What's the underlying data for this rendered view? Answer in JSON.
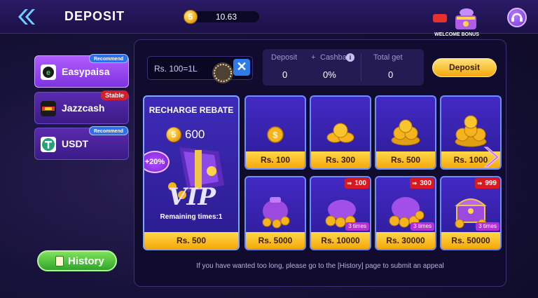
{
  "header": {
    "title": "DEPOSIT",
    "balance": "10.63",
    "balance_coin_symbol": "5",
    "welcome_bonus_label": "WELCOME BONUS"
  },
  "payment_methods": [
    {
      "label": "Easypaisa",
      "badge": "Recommend",
      "badge_color": "blue",
      "active": true
    },
    {
      "label": "Jazzcash",
      "badge": "Stable",
      "badge_color": "red",
      "active": false
    },
    {
      "label": "USDT",
      "badge": "Recommend",
      "badge_color": "blue",
      "active": false
    }
  ],
  "history_button": "History",
  "amount_input": {
    "placeholder": "Rs.  100=1L",
    "clear_symbol": "✕"
  },
  "stats": {
    "deposit_label": "Deposit",
    "plus": "+",
    "cashback_label": "Cashback",
    "info_symbol": "i",
    "deposit_value": "0",
    "cashback_value": "0%",
    "total_label": "Total get",
    "total_value": "0"
  },
  "deposit_button": "Deposit",
  "vip_card": {
    "title": "RECHARGE REBATE",
    "coin_symbol": "5",
    "amount": "600",
    "bonus_badge": "+20%",
    "remaining": "Remaining times:1",
    "price": "Rs. 500"
  },
  "tiles": [
    {
      "price": "Rs. 100",
      "plus": "",
      "times": ""
    },
    {
      "price": "Rs. 300",
      "plus": "",
      "times": ""
    },
    {
      "price": "Rs. 500",
      "plus": "",
      "times": ""
    },
    {
      "price": "Rs. 1000",
      "plus": "",
      "times": ""
    },
    {
      "price": "Rs. 5000",
      "plus": "",
      "times": ""
    },
    {
      "price": "Rs. 10000",
      "plus": "100",
      "times": "3 times"
    },
    {
      "price": "Rs. 30000",
      "plus": "300",
      "times": "3 times"
    },
    {
      "price": "Rs. 50000",
      "plus": "999",
      "times": "3 times"
    }
  ],
  "appeal_note": "If you have wanted too long, please go to the [History] page to submit an appeal",
  "colors": {
    "accent_gold": "#f5a80a",
    "panel_bg": "#110c2e",
    "tile_border": "#6c8dff",
    "history_green": "#2fa52a"
  }
}
